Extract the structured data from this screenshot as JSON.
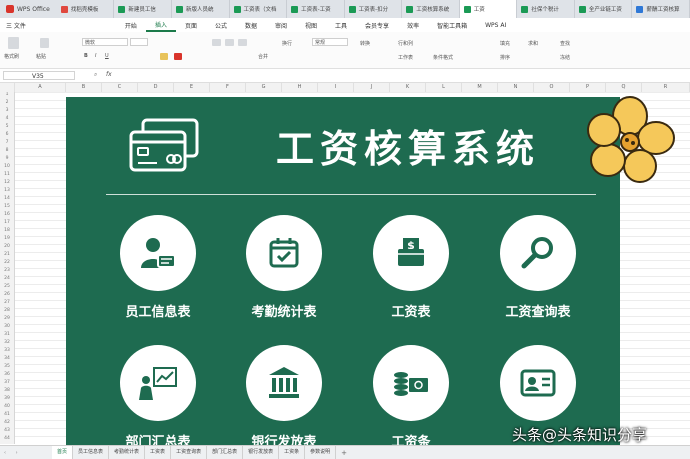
{
  "app": {
    "name": "WPS Office"
  },
  "tabs": [
    {
      "label": "找稻壳模板",
      "color": "red"
    },
    {
      "label": "新建员工信",
      "color": "green"
    },
    {
      "label": "新版人员统",
      "color": "green"
    },
    {
      "label": "工资表（文档",
      "color": "green"
    },
    {
      "label": "工资表-工资",
      "color": "green"
    },
    {
      "label": "工资表-扣分",
      "color": "green"
    },
    {
      "label": "工资核算系统",
      "color": "green"
    },
    {
      "label": "工资",
      "color": "green"
    },
    {
      "label": "社保个税计",
      "color": "green"
    },
    {
      "label": "全产业链工资",
      "color": "green"
    },
    {
      "label": "薪酬工资核算",
      "color": "blue"
    }
  ],
  "menu": {
    "file": "三 文件",
    "items": [
      "开始",
      "插入",
      "页面",
      "公式",
      "数据",
      "审阅",
      "视图",
      "工具",
      "会员专享",
      "效率",
      "智能工具箱",
      "WPS AI"
    ],
    "active": "开始"
  },
  "ribbon": {
    "font_name": "微软",
    "number_format": "常规",
    "labels": [
      "格式刷",
      "粘贴",
      "合并",
      "换行",
      "转换",
      "行和列",
      "工作表",
      "条件格式",
      "填充",
      "排序",
      "求和",
      "查找",
      "冻结"
    ]
  },
  "formula": {
    "cell_ref": "V35",
    "fx": "fx"
  },
  "columns": [
    "A",
    "B",
    "C",
    "D",
    "E",
    "F",
    "G",
    "H",
    "I",
    "J",
    "K",
    "L",
    "M",
    "N",
    "O",
    "P",
    "Q",
    "R"
  ],
  "dashboard": {
    "title": "工资核算系统",
    "buttons": [
      {
        "label": "员工信息表",
        "icon": "employee-card-icon"
      },
      {
        "label": "考勤统计表",
        "icon": "calendar-check-icon"
      },
      {
        "label": "工资表",
        "icon": "money-wallet-icon"
      },
      {
        "label": "工资查询表",
        "icon": "magnifier-icon"
      },
      {
        "label": "部门汇总表",
        "icon": "presentation-chart-icon"
      },
      {
        "label": "银行发放表",
        "icon": "bank-icon"
      },
      {
        "label": "工资条",
        "icon": "coins-cash-icon"
      },
      {
        "label": "",
        "icon": "id-card-icon"
      }
    ]
  },
  "sheets": [
    "首页",
    "员工信息表",
    "考勤统计表",
    "工资表",
    "工资查询表",
    "部门汇总表",
    "银行发放表",
    "工资条",
    "参数说明"
  ],
  "active_sheet": "首页",
  "watermark": "头条@头条知识分享"
}
